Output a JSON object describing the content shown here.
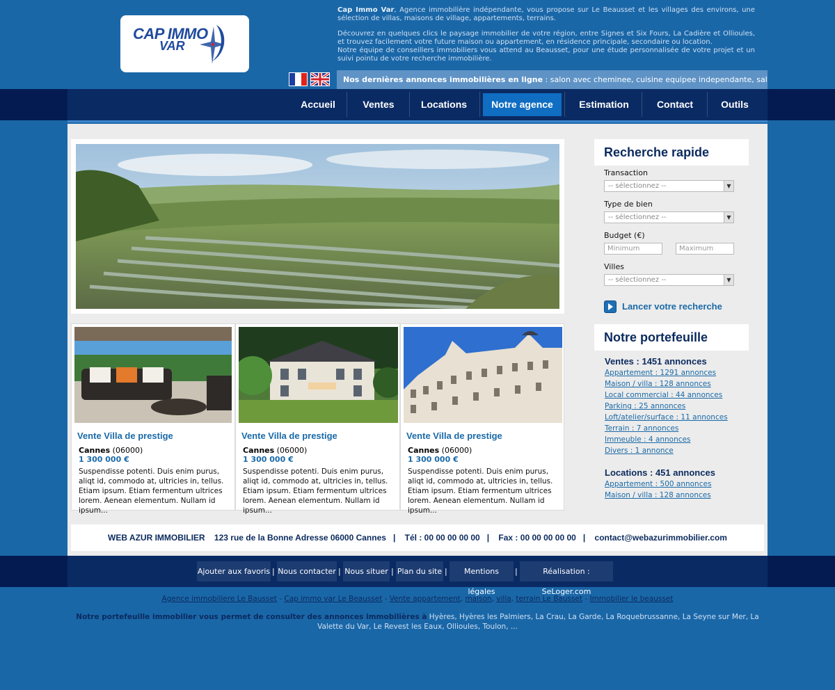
{
  "header": {
    "logo_line1": "CAP IMMO",
    "logo_line2": "VAR",
    "intro_brand": "Cap Immo Var",
    "intro_p1": ", Agence immobilière indépendante, vous propose sur Le Beausset et les villages des environs, une sélection de villas, maisons de village, appartements, terrains.",
    "intro_p2": "Découvrez en quelques clics le paysage immobilier de votre région, entre Signes et Six Fours, La Cadière et Ollioules, et trouvez facilement votre future maison ou appartement, en résidence principale, secondaire ou location.",
    "intro_p3": "Notre équipe de conseillers immobiliers vous attend au Beausset, pour une étude personnalisée de votre projet et un suivi pointu de votre recherche immobilière.",
    "ticker_label": "Nos dernières annonces immobilières en ligne",
    "ticker_text": " : salon avec cheminee, cuisine equipee independante, salle d'eau,..."
  },
  "nav": {
    "items": [
      "Accueil",
      "Ventes",
      "Locations",
      "Notre agence",
      "Estimation",
      "Contact",
      "Outils"
    ],
    "active": "Notre agence"
  },
  "listings": [
    {
      "title": "Vente Villa de prestige",
      "city": "Cannes",
      "zip": " (06000)",
      "price": "1 300 000 €",
      "desc": "Suspendisse potenti. Duis enim purus, aliqt id, commodo at, ultricies in, tellus. Etiam ipsum. Etiam fermentum ultrices lorem. Aenean elementum. Nullam id ipsum..."
    },
    {
      "title": "Vente Villa de prestige",
      "city": "Cannes",
      "zip": " (06000)",
      "price": "1 300 000 €",
      "desc": "Suspendisse potenti. Duis enim purus, aliqt id, commodo at, ultricies in, tellus. Etiam ipsum. Etiam fermentum ultrices lorem. Aenean elementum. Nullam id ipsum..."
    },
    {
      "title": "Vente Villa de prestige",
      "city": "Cannes",
      "zip": " (06000)",
      "price": "1 300 000 €",
      "desc": "Suspendisse potenti. Duis enim purus, aliqt id, commodo at, ultricies in, tellus. Etiam ipsum. Etiam fermentum ultrices lorem. Aenean elementum. Nullam id ipsum..."
    }
  ],
  "search": {
    "title": "Recherche rapide",
    "transaction_label": "Transaction",
    "transaction_value": "-- sélectionnez --",
    "type_label": "Type de bien",
    "type_value": "-- sélectionnez --",
    "budget_label": "Budget (€)",
    "min_placeholder": "Minimum",
    "max_placeholder": "Maximum",
    "villes_label": "Villes",
    "villes_value": "-- sélectionnez --",
    "submit_label": "Lancer votre recherche"
  },
  "portfolio": {
    "title": "Notre portefeuille",
    "ventes_heading": "Ventes : 1451 annonces",
    "ventes_links": [
      "Appartement : 1291 annonces",
      "Maison / villa : 128 annonces",
      "Local commercial : 44 annonces",
      "Parking : 25 annonces",
      "Loft/atelier/surface : 11 annonces",
      "Terrain : 7 annonces",
      "Immeuble : 4 annonces",
      "Divers : 1 annonce"
    ],
    "locations_heading": "Locations : 451 annonces",
    "locations_links": [
      "Appartement : 500 annonces",
      "Maison / villa : 128 annonces"
    ]
  },
  "contact": {
    "company": "WEB AZUR IMMOBILIER",
    "address": "123 rue de la Bonne Adresse 06000 Cannes",
    "tel": "Tél : 00 00 00 00 00",
    "fax": "Fax : 00 00 00 00 00",
    "email": "contact@webazurimmobilier.com"
  },
  "footer_nav": [
    "Ajouter aux favoris",
    "Nous contacter",
    "Nous situer",
    "Plan du site",
    "Mentions légales",
    "Réalisation : SeLoger.com"
  ],
  "seo": {
    "links": [
      "Agence immobiliere Le Bausset",
      "Cap immo var Le Beausset",
      "Vente appartement",
      "maison",
      "villa",
      "terrain Le Bausset",
      "Immobilier le beausset"
    ],
    "text_bold": "Notre portefeuille immobilier vous permet de consulter des annonces immobilières à",
    "text_cities": " Hyères, Hyères les Palmiers, La Crau, La Garde, La Roquebrussanne, La Seyne sur Mer, La Valette du Var, Le Revest les Eaux, Ollioules, Toulon, ..."
  },
  "colors": {
    "background": "#1a67a8",
    "nav_dark": "#041b52",
    "nav_active": "#0f6dc2",
    "link_blue": "#1a6aa8",
    "heading_navy": "#0b2a5e"
  }
}
